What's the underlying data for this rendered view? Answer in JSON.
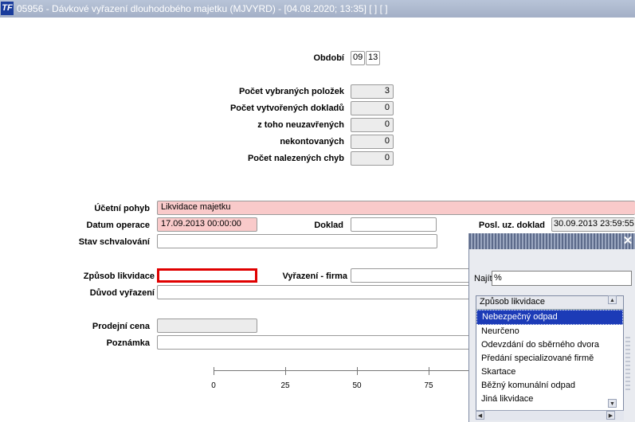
{
  "titlebar": {
    "logo": "TF",
    "title": "05956 - Dávkové vyřazení dlouhodobého majetku (MJVYRD) - [04.08.2020; 13:35]  [ ]  [ ]"
  },
  "period": {
    "label": "Období",
    "month": "09",
    "year": "13"
  },
  "stats": [
    {
      "label": "Počet vybraných položek",
      "value": "3"
    },
    {
      "label": "Počet vytvořených dokladů",
      "value": "0"
    },
    {
      "label": "z toho  neuzavřených",
      "value": "0"
    },
    {
      "label": "nekontovaných",
      "value": "0"
    },
    {
      "label": "Počet nalezených chyb",
      "value": "0"
    }
  ],
  "form": {
    "accounting_move": {
      "label": "Účetní pohyb",
      "value": "Likvidace majetku"
    },
    "operation_date": {
      "label": "Datum operace",
      "value": "17.09.2013 00:00:00"
    },
    "document": {
      "label": "Doklad",
      "value": ""
    },
    "last_document": {
      "label": "Posl. uz. doklad",
      "value": "30.09.2013 23:59:55"
    },
    "approval_state": {
      "label": "Stav schvalování",
      "value": ""
    },
    "liquidation_method": {
      "label": "Způsob likvidace",
      "value": ""
    },
    "disposal_company": {
      "label": "Vyřazení - firma",
      "value": ""
    },
    "disposal_reason": {
      "label": "Důvod vyřazení",
      "value": ""
    },
    "sale_price": {
      "label": "Prodejní cena",
      "value": ""
    },
    "note": {
      "label": "Poznámka",
      "value": ""
    }
  },
  "progress_scale": {
    "ticks": [
      "0",
      "25",
      "50",
      "75"
    ]
  },
  "lov": {
    "close_glyph": "✕",
    "find_label": "Najít",
    "find_value": "%",
    "column_header": "Způsob likvidace",
    "items": [
      "Nebezpečný odpad",
      "Neurčeno",
      "Odevzdání do sběrného dvora",
      "Předání specializované firmě",
      "Skartace",
      "Běžný komunální odpad",
      "Jiná likvidace"
    ],
    "selected_index": 0
  }
}
